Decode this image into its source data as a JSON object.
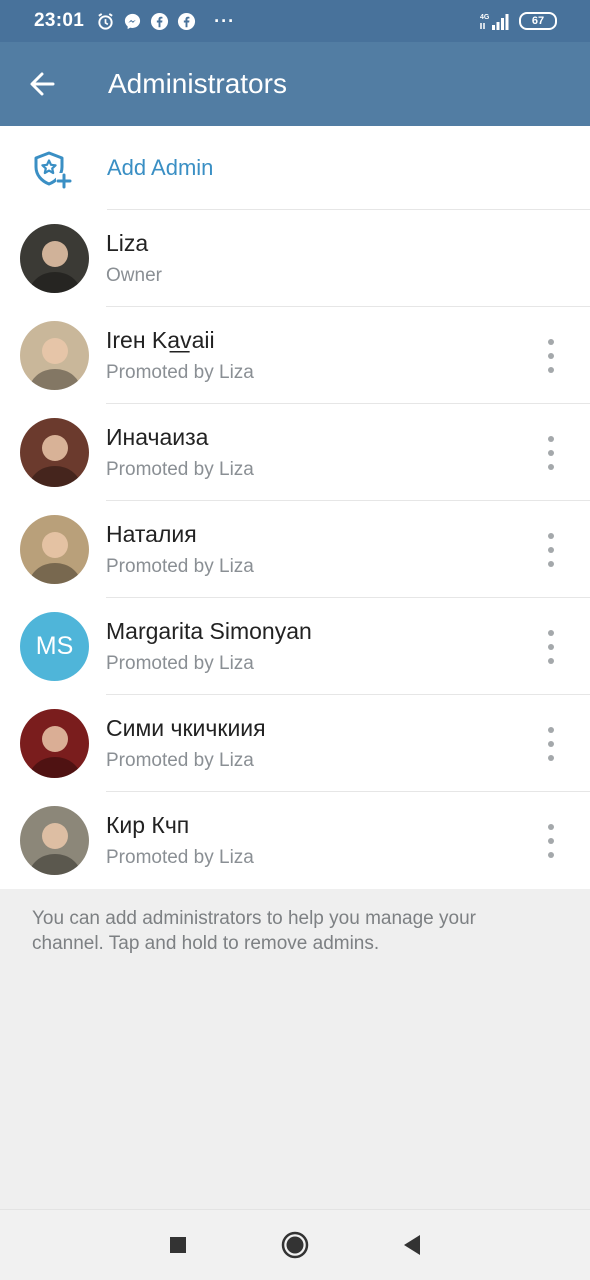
{
  "status_bar": {
    "time": "23:01",
    "icons": [
      "alarm-icon",
      "messenger-icon",
      "facebook-icon",
      "facebook-icon"
    ],
    "more": "···",
    "network": "4G",
    "battery": "67"
  },
  "app_bar": {
    "title": "Administrators",
    "back_icon": "arrow-left-icon"
  },
  "add_admin": {
    "label": "Add Admin",
    "icon": "shield-star-plus-icon"
  },
  "admins": [
    {
      "name": "Liza",
      "role": "Owner",
      "avatar_color": "#3b3a35",
      "has_menu": false
    },
    {
      "name": "Irен Ka͟vaii",
      "role": "Promoted by Liza",
      "avatar_color": "#c9b79a",
      "has_menu": true
    },
    {
      "name": "Иначаиза",
      "role": "Promoted by Liza",
      "avatar_color": "#6b3a2d",
      "has_menu": true
    },
    {
      "name": "Наталия",
      "role": "Promoted by Liza",
      "avatar_color": "#b9a07a",
      "has_menu": true
    },
    {
      "name": "Margarita Simonyan",
      "role": "Promoted by Liza",
      "initials": "MS",
      "avatar_color": "#4fb5d9",
      "has_menu": true
    },
    {
      "name": "Сими чкичкиия",
      "role": "Promoted by Liza",
      "avatar_color": "#7a1d1d",
      "has_menu": true
    },
    {
      "name": "Кир Кчп",
      "role": "Promoted by Liza",
      "avatar_color": "#8c8779",
      "has_menu": true
    }
  ],
  "footer_note": "You can add administrators to help you manage your channel. Tap and hold to remove admins.",
  "nav_bar": {
    "buttons": [
      "recents-square-icon",
      "home-circle-icon",
      "back-triangle-icon"
    ]
  },
  "colors": {
    "status_bar": "#48729b",
    "app_bar": "#527da3",
    "accent": "#3a8fc4",
    "background": "#efefef"
  }
}
